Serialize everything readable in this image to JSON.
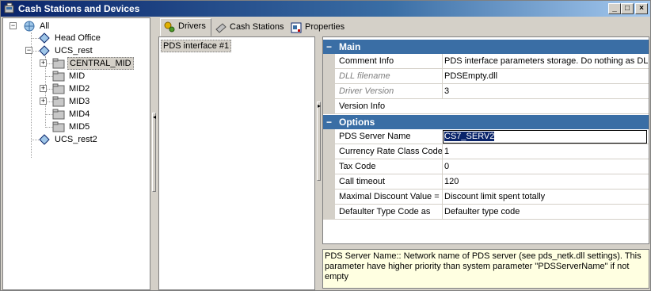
{
  "window": {
    "title": "Cash Stations and Devices"
  },
  "title_buttons": {
    "minimize": "_",
    "maximize": "□",
    "close": "×"
  },
  "tree": {
    "root": "All",
    "items": [
      {
        "label": "Head Office"
      },
      {
        "label": "UCS_rest"
      },
      {
        "label": "CENTRAL_MID"
      },
      {
        "label": "MID"
      },
      {
        "label": "MID2"
      },
      {
        "label": "MID3"
      },
      {
        "label": "MID4"
      },
      {
        "label": "MID5"
      },
      {
        "label": "UCS_rest2"
      }
    ]
  },
  "tabs": [
    {
      "label": "Drivers",
      "icon": "drivers-icon",
      "active": true
    },
    {
      "label": "Cash Stations",
      "icon": "cash-stations-icon"
    },
    {
      "label": "Properties",
      "icon": "properties-icon"
    }
  ],
  "drivers": [
    "PDS interface #1"
  ],
  "property_grid": {
    "categories": [
      {
        "name": "Main",
        "toggle": "−",
        "properties": [
          {
            "name": "Comment Info",
            "value": "PDS interface parameters storage. Do nothing as DLL."
          },
          {
            "name": "DLL filename",
            "value": "PDSEmpty.dll"
          },
          {
            "name": "Driver Version",
            "value": "3"
          },
          {
            "name": "Version Info",
            "value": ""
          }
        ]
      },
      {
        "name": "Options",
        "toggle": "−",
        "properties": [
          {
            "name": "PDS Server Name",
            "value": "CS7_SERV2"
          },
          {
            "name": "Currency Rate Class Code",
            "value": "1"
          },
          {
            "name": "Tax Code",
            "value": "0"
          },
          {
            "name": "Call timeout",
            "value": "120"
          },
          {
            "name": "Maximal Discount Value =",
            "value": "Discount limit spent totally"
          },
          {
            "name": "Defaulter Type Code as",
            "value": "Defaulter type code"
          }
        ]
      }
    ]
  },
  "description": "PDS Server Name:: Network name of PDS server (see pds_netk.dll settings). This parameter have higher priority than system parameter \"PDSServerName\" if not empty",
  "colors": {
    "title_start": "#0a246a",
    "title_end": "#a6caf0",
    "category": "#3a6ea5",
    "description_bg": "#ffffe1"
  }
}
